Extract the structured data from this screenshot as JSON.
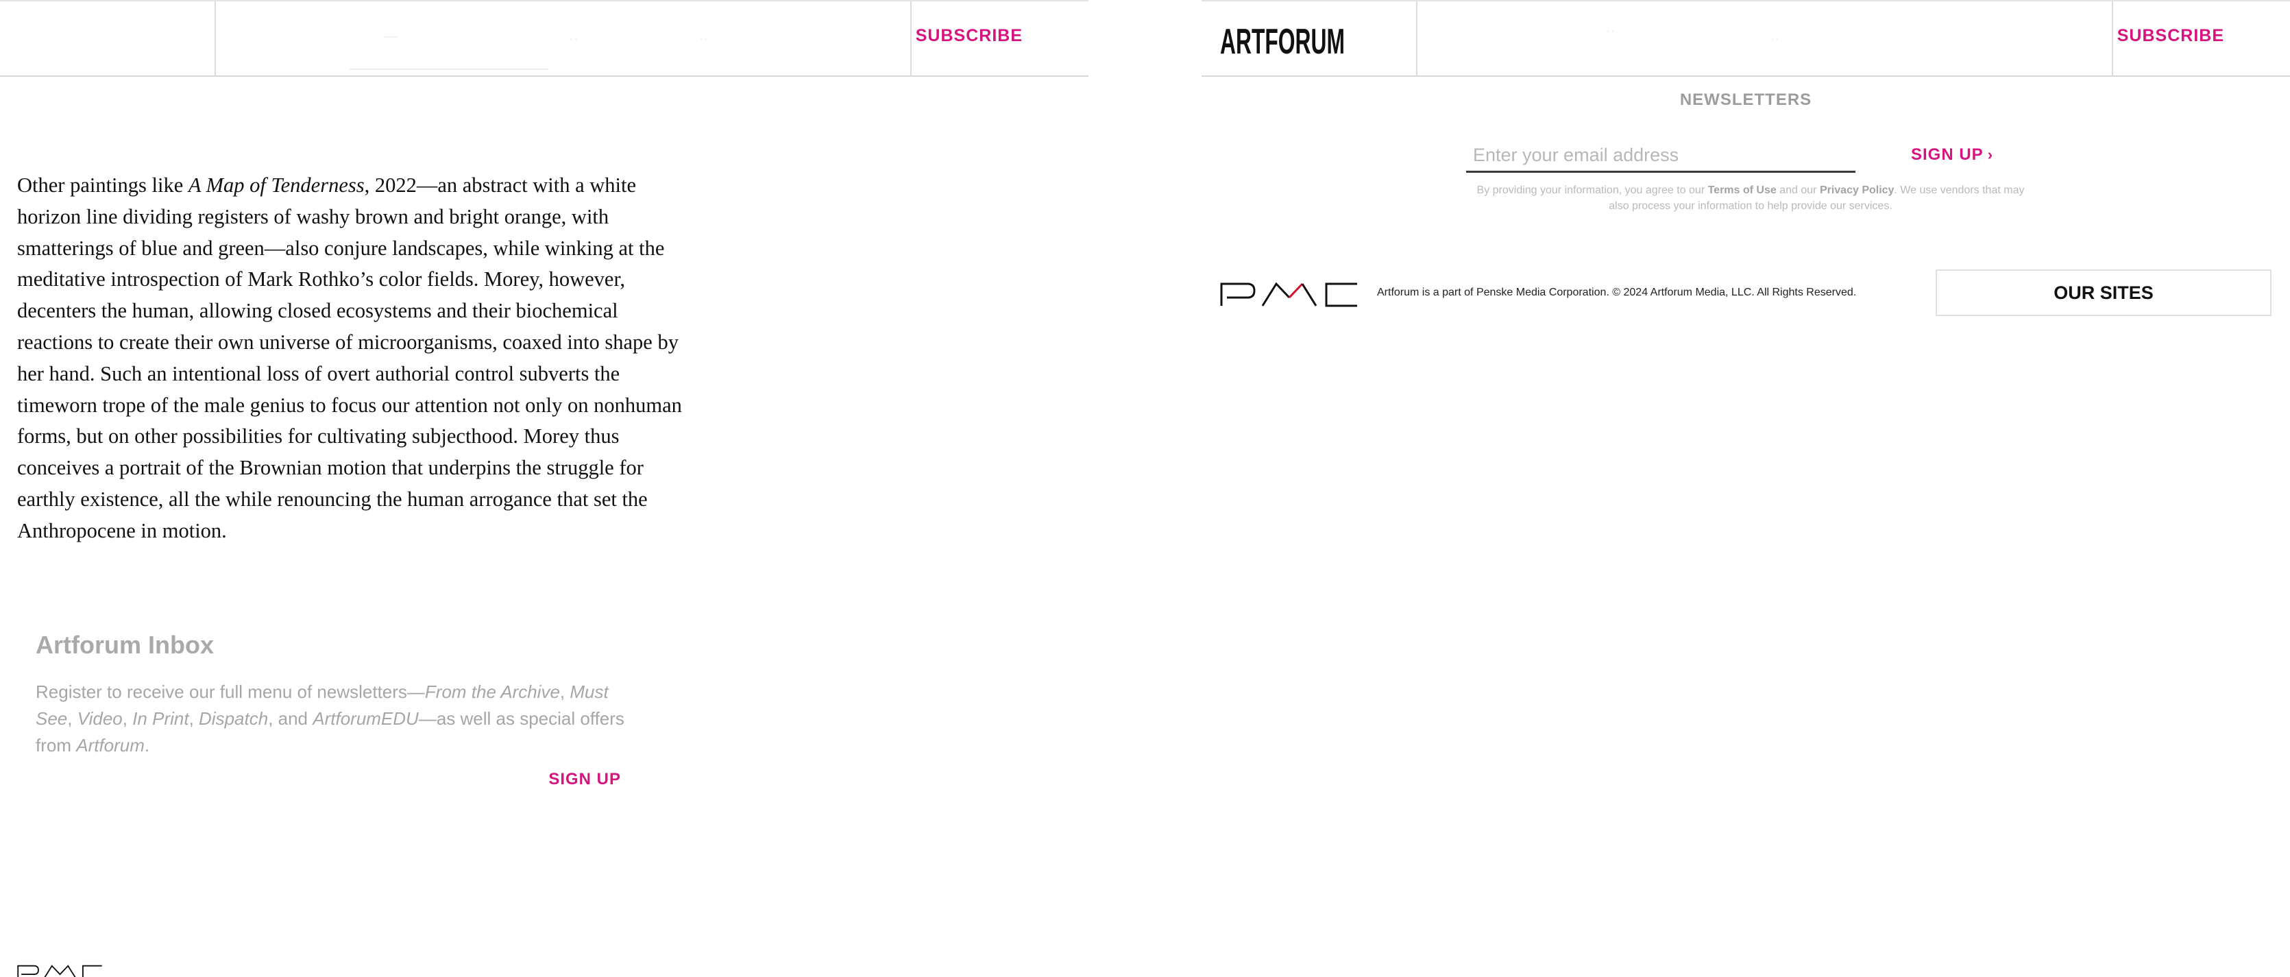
{
  "header_left": {
    "subscribe_label": "SUBSCRIBE"
  },
  "header_right": {
    "logo_text": "ARTFORUM",
    "subscribe_label": "SUBSCRIBE"
  },
  "article": {
    "seg1": "Other paintings like ",
    "seg2_italic": "A Map of Tenderness",
    "seg3": ", 2022—an abstract with a white horizon line dividing registers of washy brown and bright orange, with smatterings of blue and green—also conjure landscapes, while winking at the meditative introspection of Mark Rothko’s color fields. Morey, however, decenters the human, allowing closed ecosystems and their biochemical reactions to create their own universe of microorganisms, coaxed into shape by her hand. Such an intentional loss of overt authorial control subverts the timeworn trope of the male genius to focus our attention not only on nonhuman forms, but on other possibilities for cultivating subjecthood. Morey thus conceives a portrait of the Brownian motion that underpins the struggle for earthly existence, all the while renouncing the human arrogance that set the Anthropocene in motion."
  },
  "inbox": {
    "title": "Artforum Inbox",
    "d1": "Register to receive our full menu of newsletters—",
    "d2": "From the Archive",
    "d3": ", ",
    "d4": "Must See",
    "d5": ", ",
    "d6": "Video",
    "d7": ", ",
    "d8": "In Print",
    "d9": ", ",
    "d10": "Dispatch",
    "d11": ", and ",
    "d12": "ArtforumEDU",
    "d13": "—as well as special offers from ",
    "d14": "Artforum",
    "d15": ".",
    "signup_label": "SIGN UP"
  },
  "footer": {
    "newsletters_label": "NEWSLETTERS",
    "email_placeholder": "Enter your email address",
    "signup_label": "SIGN UP",
    "legal1": "By providing your information, you agree to our ",
    "terms": "Terms of Use",
    "legal2": " and our ",
    "privacy": "Privacy Policy",
    "legal3": ". We use vendors that may also process your information to help provide our services.",
    "copyright": "Artforum is a part of Penske Media Corporation. © 2024 Artforum Media, LLC. All Rights Reserved.",
    "our_sites_label": "OUR SITES"
  },
  "colors": {
    "accent": "#d6137e",
    "muted": "#a6a6a6",
    "pmc_red": "#d0112b"
  },
  "icons": {
    "chevron": "chevron-right-icon",
    "pmc": "pmc-logo-icon"
  }
}
